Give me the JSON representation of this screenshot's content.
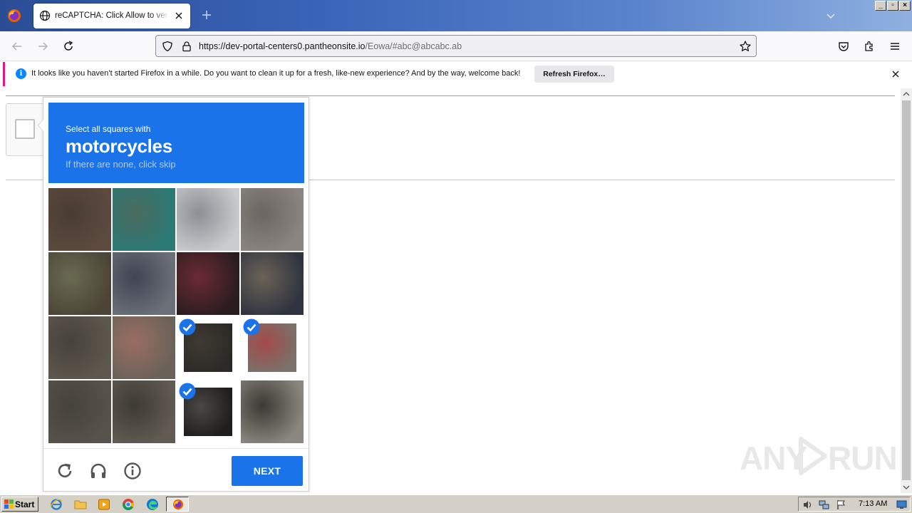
{
  "browser": {
    "tab_title": "reCAPTCHA: Click Allow to verify that you are not a robot",
    "url_host": "https://dev-portal-centers0.pantheonsite.io",
    "url_path": "/Eowa/#abc@abcabc.ab"
  },
  "notification": {
    "message": "It looks like you haven’t started Firefox in a while. Do you want to clean it up for a fresh, like-new experience? And by the way, welcome back!",
    "button_label": "Refresh Firefox…",
    "accent_color": "#e31587"
  },
  "captcha": {
    "instruction": "Select all squares with",
    "target": "motorcycles",
    "hint": "If there are none, click skip",
    "next_label": "NEXT",
    "accent_color": "#1a73e8",
    "selected_tiles": [
      10,
      11,
      14
    ],
    "tiles": [
      {
        "colors": [
          "#5c4a3e",
          "#4a3c32"
        ]
      },
      {
        "colors": [
          "#2c7a76",
          "#4a6b60"
        ]
      },
      {
        "colors": [
          "#c9cbcf",
          "#8d8f94"
        ]
      },
      {
        "colors": [
          "#8a8580",
          "#6b6661"
        ]
      },
      {
        "colors": [
          "#4b4536",
          "#6a6a52"
        ]
      },
      {
        "colors": [
          "#6a6f78",
          "#404552"
        ]
      },
      {
        "colors": [
          "#2a1d1f",
          "#6b2a34"
        ]
      },
      {
        "colors": [
          "#2f3440",
          "#6a6256"
        ]
      },
      {
        "colors": [
          "#5d574d",
          "#47423b"
        ]
      },
      {
        "colors": [
          "#6a6258",
          "#9a6d62"
        ]
      },
      {
        "colors": [
          "#2b2a26",
          "#3f3a33"
        ]
      },
      {
        "colors": [
          "#7a716a",
          "#a34a4a"
        ]
      },
      {
        "colors": [
          "#57524b",
          "#46423c"
        ]
      },
      {
        "colors": [
          "#615b52",
          "#3e3a35"
        ]
      },
      {
        "colors": [
          "#1f1e1d",
          "#4a4844"
        ]
      },
      {
        "colors": [
          "#8a8780",
          "#3c3934"
        ]
      }
    ]
  },
  "taskbar": {
    "start_label": "Start",
    "clock": "7:13 AM"
  },
  "watermark": {
    "left": "ANY",
    "right": "RUN"
  }
}
